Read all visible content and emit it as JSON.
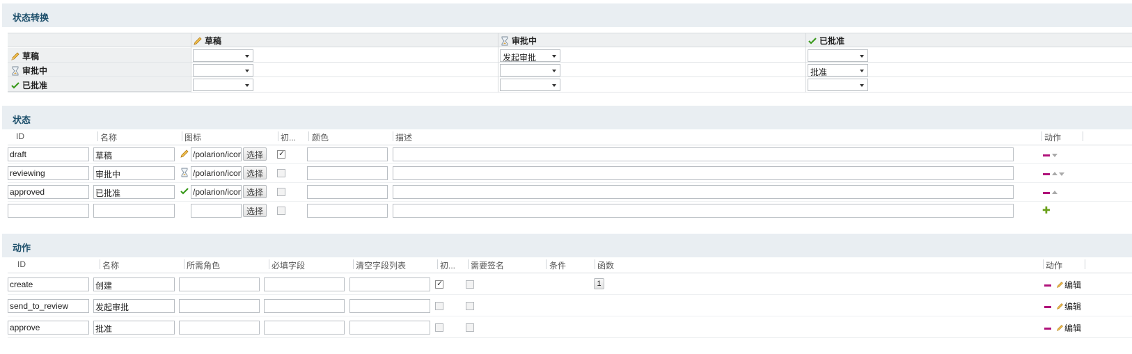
{
  "sections": {
    "transitions": "状态转换",
    "states": "状态",
    "actions": "动作"
  },
  "matrix": {
    "columns": [
      "草稿",
      "审批中",
      "已批准"
    ],
    "rows": [
      "草稿",
      "审批中",
      "已批准"
    ],
    "cells": [
      [
        "",
        "发起审批",
        ""
      ],
      [
        "",
        "",
        "批准"
      ],
      [
        "",
        "",
        ""
      ]
    ]
  },
  "states": {
    "headers": [
      "ID",
      "名称",
      "图标",
      "初...",
      "颜色",
      "描述",
      "动作"
    ],
    "select_label": "选择",
    "rows": [
      {
        "id": "draft",
        "name": "草稿",
        "icon_path": "/polarion/icon",
        "icon": "pencil-icon",
        "initial": true,
        "color": "",
        "desc": ""
      },
      {
        "id": "reviewing",
        "name": "审批中",
        "icon_path": "/polarion/icon",
        "icon": "hourglass-icon",
        "initial": false,
        "color": "",
        "desc": ""
      },
      {
        "id": "approved",
        "name": "已批准",
        "icon_path": "/polarion/icon",
        "icon": "checkmark-icon",
        "initial": false,
        "color": "",
        "desc": ""
      },
      {
        "id": "",
        "name": "",
        "icon_path": "",
        "icon": "",
        "initial": false,
        "color": "",
        "desc": ""
      }
    ]
  },
  "actions": {
    "headers": [
      "ID",
      "名称",
      "所需角色",
      "必填字段",
      "清空字段列表",
      "初...",
      "需要签名",
      "条件",
      "函数",
      "动作"
    ],
    "edit_label": "编辑",
    "rows": [
      {
        "id": "create",
        "name": "创建",
        "initial": true,
        "func_count": "1"
      },
      {
        "id": "send_to_review",
        "name": "发起审批",
        "initial": false,
        "func_count": ""
      },
      {
        "id": "approve",
        "name": "批准",
        "initial": false,
        "func_count": ""
      }
    ]
  },
  "colors": {
    "section_bg": "#e9eef2",
    "section_text": "#1d4f6b",
    "remove": "#b0127a",
    "add": "#6aa01a"
  }
}
